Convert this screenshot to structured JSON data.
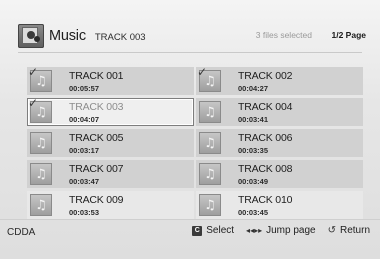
{
  "header": {
    "title": "Music",
    "track": "TRACK 003",
    "selected": "3 files selected",
    "page": "1/2 Page"
  },
  "tracks": [
    {
      "title": "TRACK 001",
      "duration": "00:05:57",
      "checked": true
    },
    {
      "title": "TRACK 002",
      "duration": "00:04:27",
      "checked": true
    },
    {
      "title": "TRACK 003",
      "duration": "00:04:07",
      "checked": true,
      "focused": true
    },
    {
      "title": "TRACK 004",
      "duration": "00:03:41",
      "checked": false
    },
    {
      "title": "TRACK 005",
      "duration": "00:03:17",
      "checked": false
    },
    {
      "title": "TRACK 006",
      "duration": "00:03:35",
      "checked": false
    },
    {
      "title": "TRACK 007",
      "duration": "00:03:47",
      "checked": false
    },
    {
      "title": "TRACK 008",
      "duration": "00:03:49",
      "checked": false
    },
    {
      "title": "TRACK 009",
      "duration": "00:03:53",
      "checked": false
    },
    {
      "title": "TRACK 010",
      "duration": "00:03:45",
      "checked": false
    }
  ],
  "footer": {
    "source": "CDDA",
    "select_key": "C",
    "select_label": "Select",
    "jump_label": "Jump page",
    "return_label": "Return"
  },
  "icons": {
    "track_thumb": "music-note-icon",
    "check": "checkmark-icon",
    "jump": "skip-arrows-icon",
    "return": "return-arrow-icon"
  }
}
